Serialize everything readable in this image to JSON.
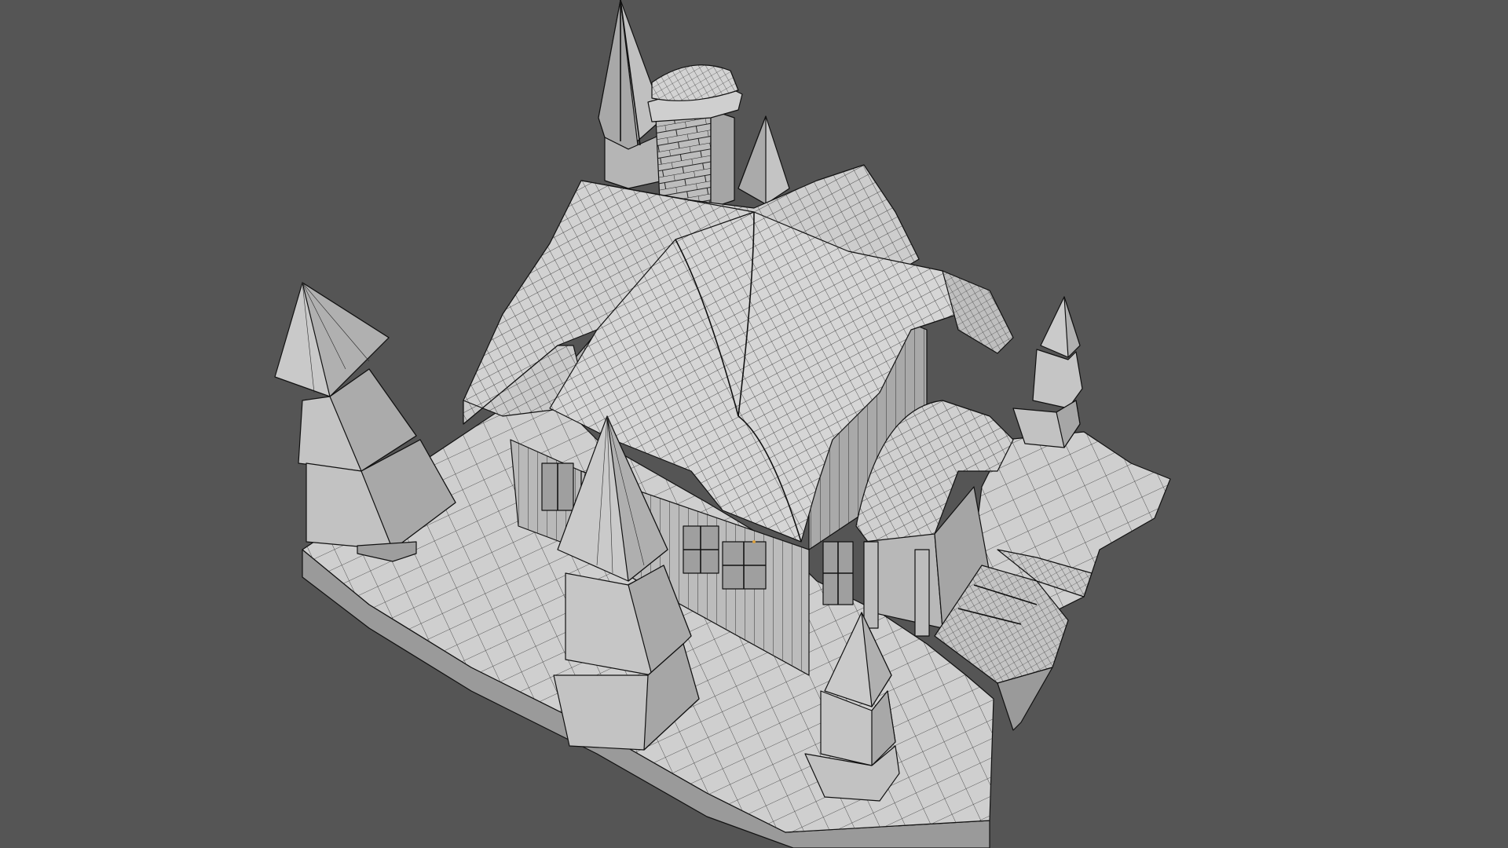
{
  "viewport": {
    "background_color": "#555555",
    "mesh_color": "#c8c8c8",
    "wire_color": "#1a1a1a"
  },
  "objects": [
    "ground-snow-base",
    "cottage",
    "cottage-roof",
    "chimney",
    "porch",
    "steps",
    "pine-tree-left",
    "pine-tree-front",
    "pine-tree-small-front",
    "pine-tree-right",
    "spire-back-large",
    "spire-back-small"
  ]
}
